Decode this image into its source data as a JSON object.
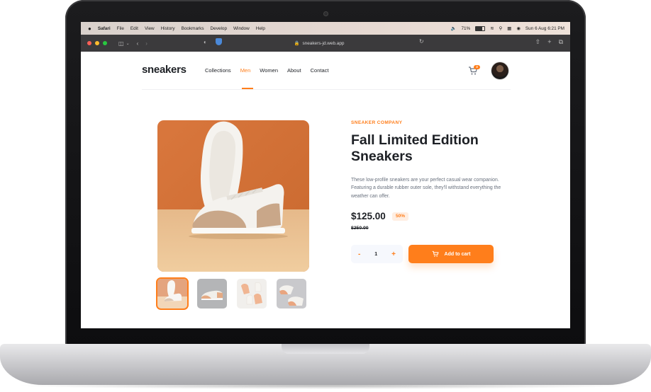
{
  "menubar": {
    "apple": "",
    "app": "Safari",
    "items": [
      "File",
      "Edit",
      "View",
      "History",
      "Bookmarks",
      "Develop",
      "Window",
      "Help"
    ],
    "battery": "71%",
    "datetime": "Sun 6 Aug  6:21 PM"
  },
  "browser": {
    "url": "sneakers-jd.web.app"
  },
  "site": {
    "logo": "sneakers",
    "nav": [
      "Collections",
      "Men",
      "Women",
      "About",
      "Contact"
    ],
    "active_nav": "Men",
    "cart_count": "3",
    "accent_color": "#ff7e1b"
  },
  "product": {
    "company": "SNEAKER COMPANY",
    "title": "Fall Limited Edition Sneakers",
    "description": "These low-profile sneakers are your perfect casual wear companion. Featuring a durable rubber outer sole, they'll withstand everything the weather can offer.",
    "price": "$125.00",
    "discount": "50%",
    "old_price": "$250.00",
    "quantity": "1",
    "minus": "-",
    "plus": "+",
    "add_to_cart": "Add to cart"
  }
}
